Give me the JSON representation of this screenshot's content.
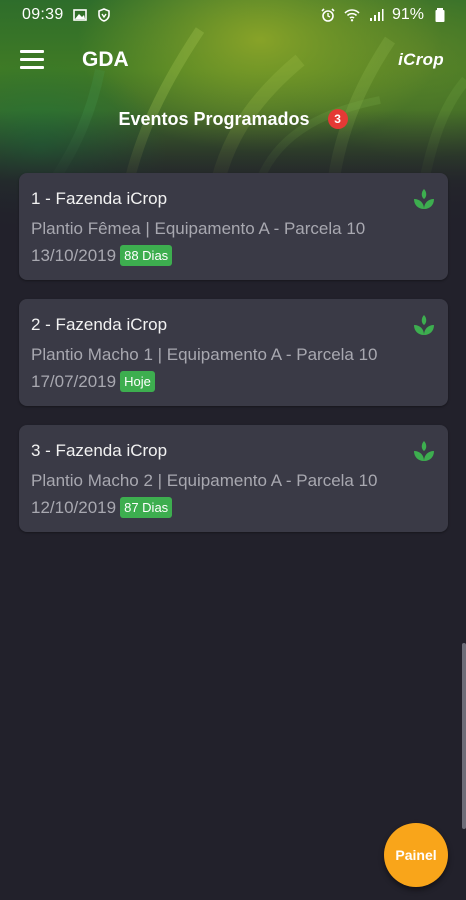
{
  "status_bar": {
    "time": "09:39",
    "battery": "91%",
    "icons": [
      "image-icon",
      "vpn-icon",
      "alarm-icon",
      "wifi-icon",
      "signal-icon",
      "battery-icon"
    ]
  },
  "app_bar": {
    "title": "GDA",
    "brand": "iCrop",
    "menu_icon": "hamburger-menu-icon"
  },
  "section": {
    "title": "Eventos Programados",
    "count": "3"
  },
  "events": [
    {
      "title": "1 - Fazenda iCrop",
      "subtitle": "Plantio Fêmea | Equipamento A - Parcela 10",
      "date": "13/10/2019",
      "tag": "88 Dias",
      "icon": "sprout-icon"
    },
    {
      "title": "2 - Fazenda iCrop",
      "subtitle": "Plantio Macho 1 | Equipamento A - Parcela 10",
      "date": "17/07/2019",
      "tag": "Hoje",
      "icon": "sprout-icon"
    },
    {
      "title": "3 - Fazenda iCrop",
      "subtitle": "Plantio Macho 2 | Equipamento A - Parcela 10",
      "date": "12/10/2019",
      "tag": "87 Dias",
      "icon": "sprout-icon"
    }
  ],
  "fab": {
    "label": "Painel"
  },
  "colors": {
    "background": "#22212b",
    "card": "#3a3a46",
    "accent_green": "#3dae4f",
    "badge_red": "#e53935",
    "fab_orange": "#f9a51a"
  }
}
